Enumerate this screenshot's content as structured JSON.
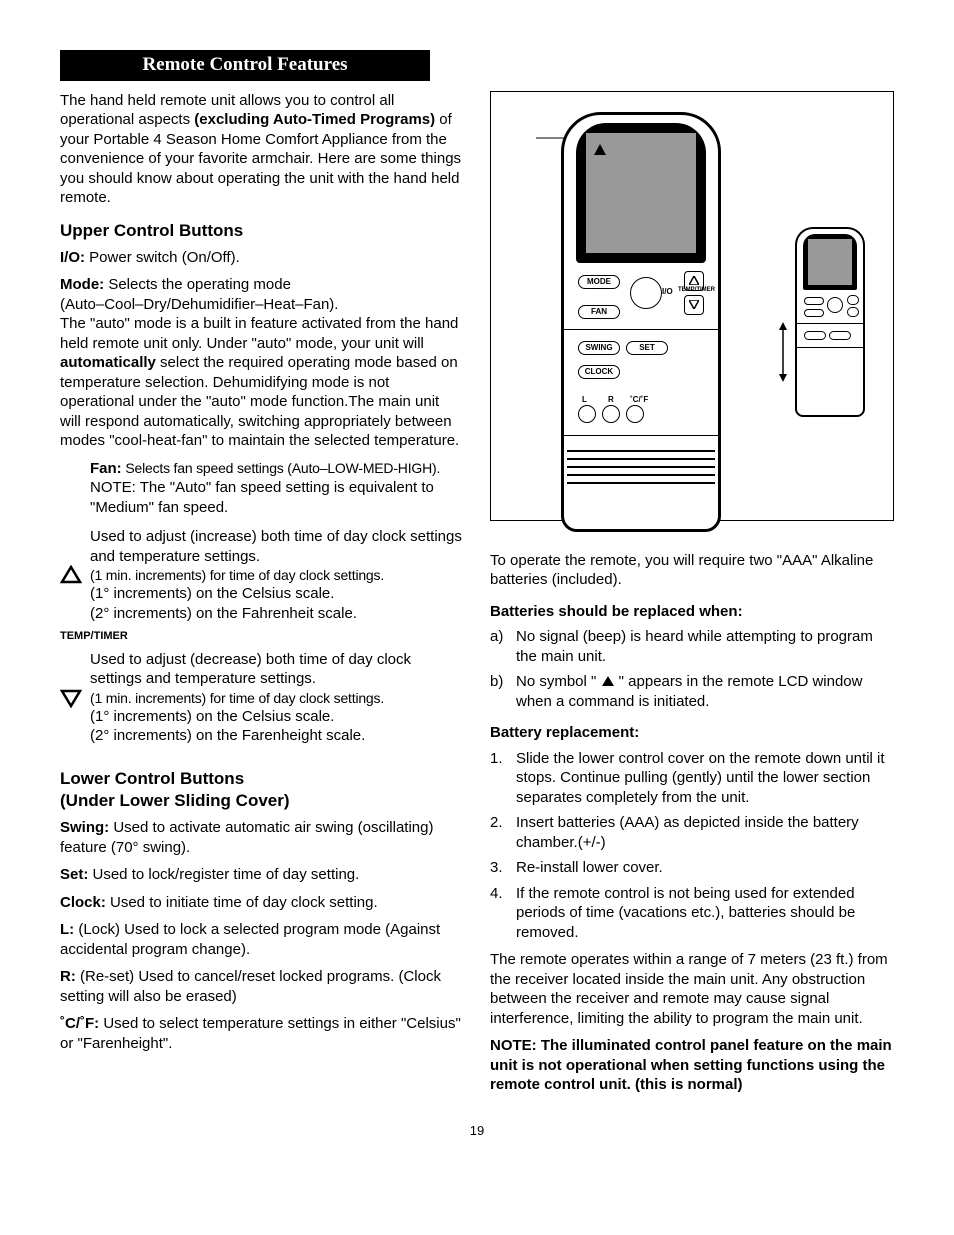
{
  "header": {
    "title": "Remote Control Features"
  },
  "left": {
    "intro_1": "The hand held remote unit allows you to control all operational aspects ",
    "intro_bold": "(excluding Auto-Timed Programs)",
    "intro_2": " of your Portable 4 Season Home Comfort Appliance from the convenience of your favorite armchair.  Here are some things you should know about operating the unit with the hand held remote.",
    "upper_heading": "Upper Control Buttons",
    "io_label": "I/O:",
    "io_text": "  Power switch (On/Off).",
    "mode_label": "Mode:",
    "mode_line1": "  Selects the operating mode",
    "mode_line2": "(Auto–Cool–Dry/Dehumidifier–Heat–Fan).",
    "mode_para_a": "The \"auto\" mode is a built in feature activated from the hand held remote unit only.  Under \"auto\" mode, your unit will ",
    "mode_auto_bold": "automatically",
    "mode_para_b": " select the required operating mode based on temperature selection. Dehumidifying mode is not operational under the \"auto\" mode function.The main unit will respond automatically, switching appropriately between modes \"cool-heat-fan\" to maintain the selected temperature.",
    "fan_label": "Fan:",
    "fan_text1": "  Selects fan speed settings (Auto–LOW-MED-HIGH).",
    "fan_text2": "NOTE: The \"Auto\" fan speed setting is equivalent to \"Medium\" fan speed.",
    "up_l1": "Used to adjust (increase) both time of day clock settings and temperature settings.",
    "up_l2": "(1 min. increments) for time of day clock settings.",
    "up_l3": "(1° increments) on the Celsius scale.",
    "up_l4": "(2° increments) on the Fahrenheit scale.",
    "tt_label": "TEMP/TIMER",
    "dn_l1": "Used to adjust (decrease) both time of day clock settings and temperature settings.",
    "dn_l2": "(1 min. increments) for time of day clock settings.",
    "dn_l3": "(1° increments) on the Celsius scale.",
    "dn_l4": "(2° increments) on the Farenheight scale.",
    "lower_heading1": "Lower Control Buttons",
    "lower_heading2": "(Under Lower Sliding Cover)",
    "swing_label": "Swing:",
    "swing_text": "  Used to activate automatic air swing (oscillating) feature (70° swing).",
    "set_label": "Set:",
    "set_text": "  Used to lock/register time of day setting.",
    "clock_label": "Clock:",
    "clock_text": "  Used to initiate time of day clock setting.",
    "l_label": "L:",
    "l_text": "  (Lock) Used to lock a selected program mode (Against accidental program change).",
    "r_label": "R:",
    "r_text": "  (Re-set) Used to cancel/reset locked programs. (Clock setting will also be erased)",
    "cf_label": "˚C/˚F:",
    "cf_text": "  Used to select temperature settings in either \"Celsius\" or \"Farenheight\"."
  },
  "right": {
    "operate": "To operate the remote, you will require two \"AAA\" Alkaline batteries (included).",
    "replace_heading": "Batteries should be replaced when:",
    "a_marker": "a)",
    "a_text": "No signal (beep) is heard while attempting to program the main unit.",
    "b_marker": "b)",
    "b_text1": "No symbol \" ",
    "b_text2": " \" appears in the remote LCD window  when a command is initiated.",
    "batt_heading": "Battery replacement:",
    "s1m": "1.",
    "s1": "Slide the lower control cover on the remote down until it stops.  Continue pulling (gently) until the lower section separates completely from the unit.",
    "s2m": "2.",
    "s2": "Insert batteries (AAA) as depicted inside the battery chamber.(+/-)",
    "s3m": "3.",
    "s3": "Re-install lower cover.",
    "s4m": "4.",
    "s4": "If the remote control is not being used for extended periods of time (vacations etc.), batteries should be removed.",
    "range": "The remote operates within a range of 7 meters (23 ft.) from the receiver located inside the main unit. Any obstruction between the receiver and remote may cause signal interference, limiting the ability to program the main unit.",
    "note": "NOTE:  The illuminated control panel feature on the main unit is not operational when setting functions using the remote control unit. (this is normal)"
  },
  "remote_labels": {
    "mode": "MODE",
    "fan": "FAN",
    "io": "I/O",
    "tt": "TEMP/TIMER",
    "swing": "SWING",
    "set": "SET",
    "clock": "CLOCK",
    "L": "L",
    "R": "R",
    "cf": "˚C/˚F"
  },
  "page_number": "19"
}
